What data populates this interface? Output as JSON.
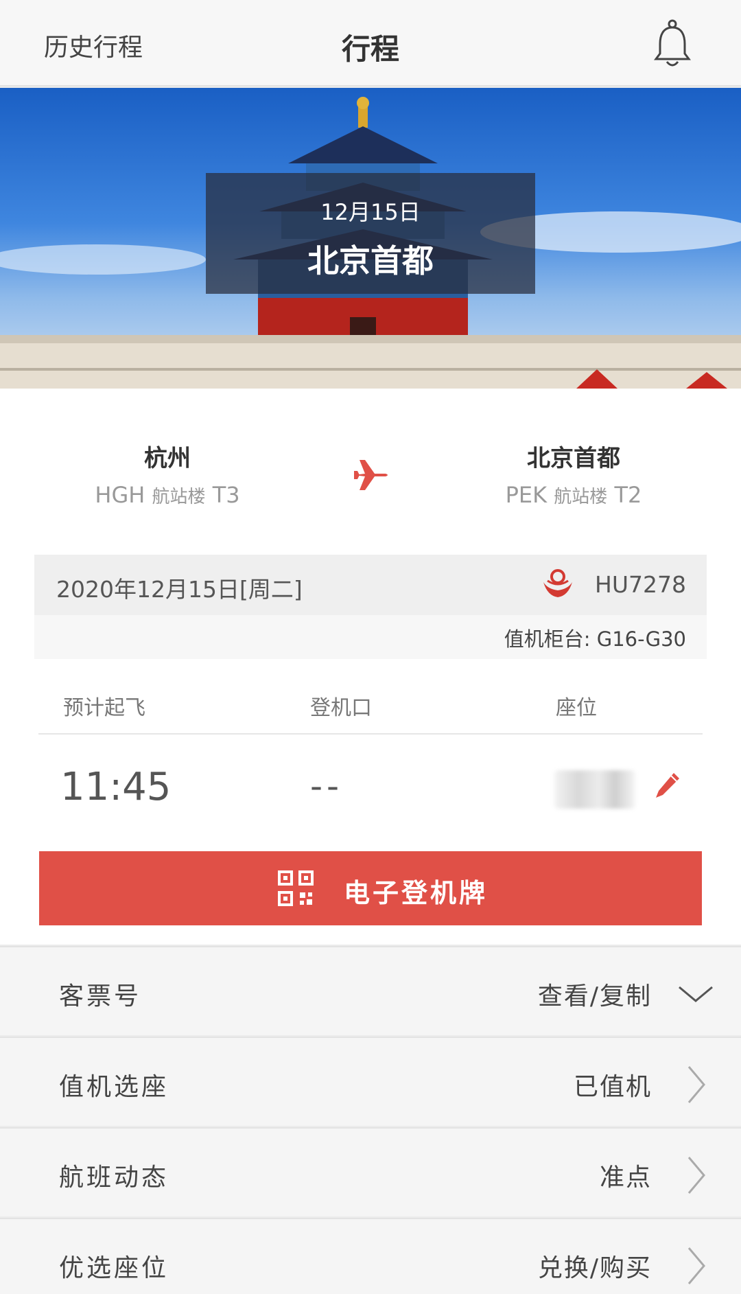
{
  "header": {
    "history_label": "历史行程",
    "title": "行程",
    "bell_icon": "bell-icon"
  },
  "banner": {
    "date": "12月15日",
    "city": "北京首都"
  },
  "route": {
    "origin": {
      "city": "杭州",
      "code": "HGH",
      "terminal_label": "航站楼",
      "terminal": "T3"
    },
    "destination": {
      "city": "北京首都",
      "code": "PEK",
      "terminal_label": "航站楼",
      "terminal": "T2"
    },
    "plane_icon": "airplane-icon",
    "accent_color": "#e05047"
  },
  "flight": {
    "date": "2020年12月15日[周二]",
    "airline_icon": "hainan-airlines-logo-icon",
    "flight_no": "HU7278",
    "checkin_counter": "值机柜台: G16-G30"
  },
  "details": {
    "dep_label": "预计起飞",
    "gate_label": "登机口",
    "seat_label": "座位",
    "dep_time": "11:45",
    "gate": "--",
    "edit_icon": "pencil-icon"
  },
  "boarding_pass": {
    "label": "电子登机牌",
    "icon": "qr-code-icon",
    "color": "#e05047"
  },
  "rows": [
    {
      "label": "客票号",
      "value": "查看/复制",
      "icon": "chevron-down-icon"
    },
    {
      "label": "值机选座",
      "value": "已值机",
      "icon": "chevron-right-icon"
    },
    {
      "label": "航班动态",
      "value": "准点",
      "icon": "chevron-right-icon"
    },
    {
      "label": "优选座位",
      "value": "兑换/购买",
      "icon": "chevron-right-icon"
    }
  ]
}
